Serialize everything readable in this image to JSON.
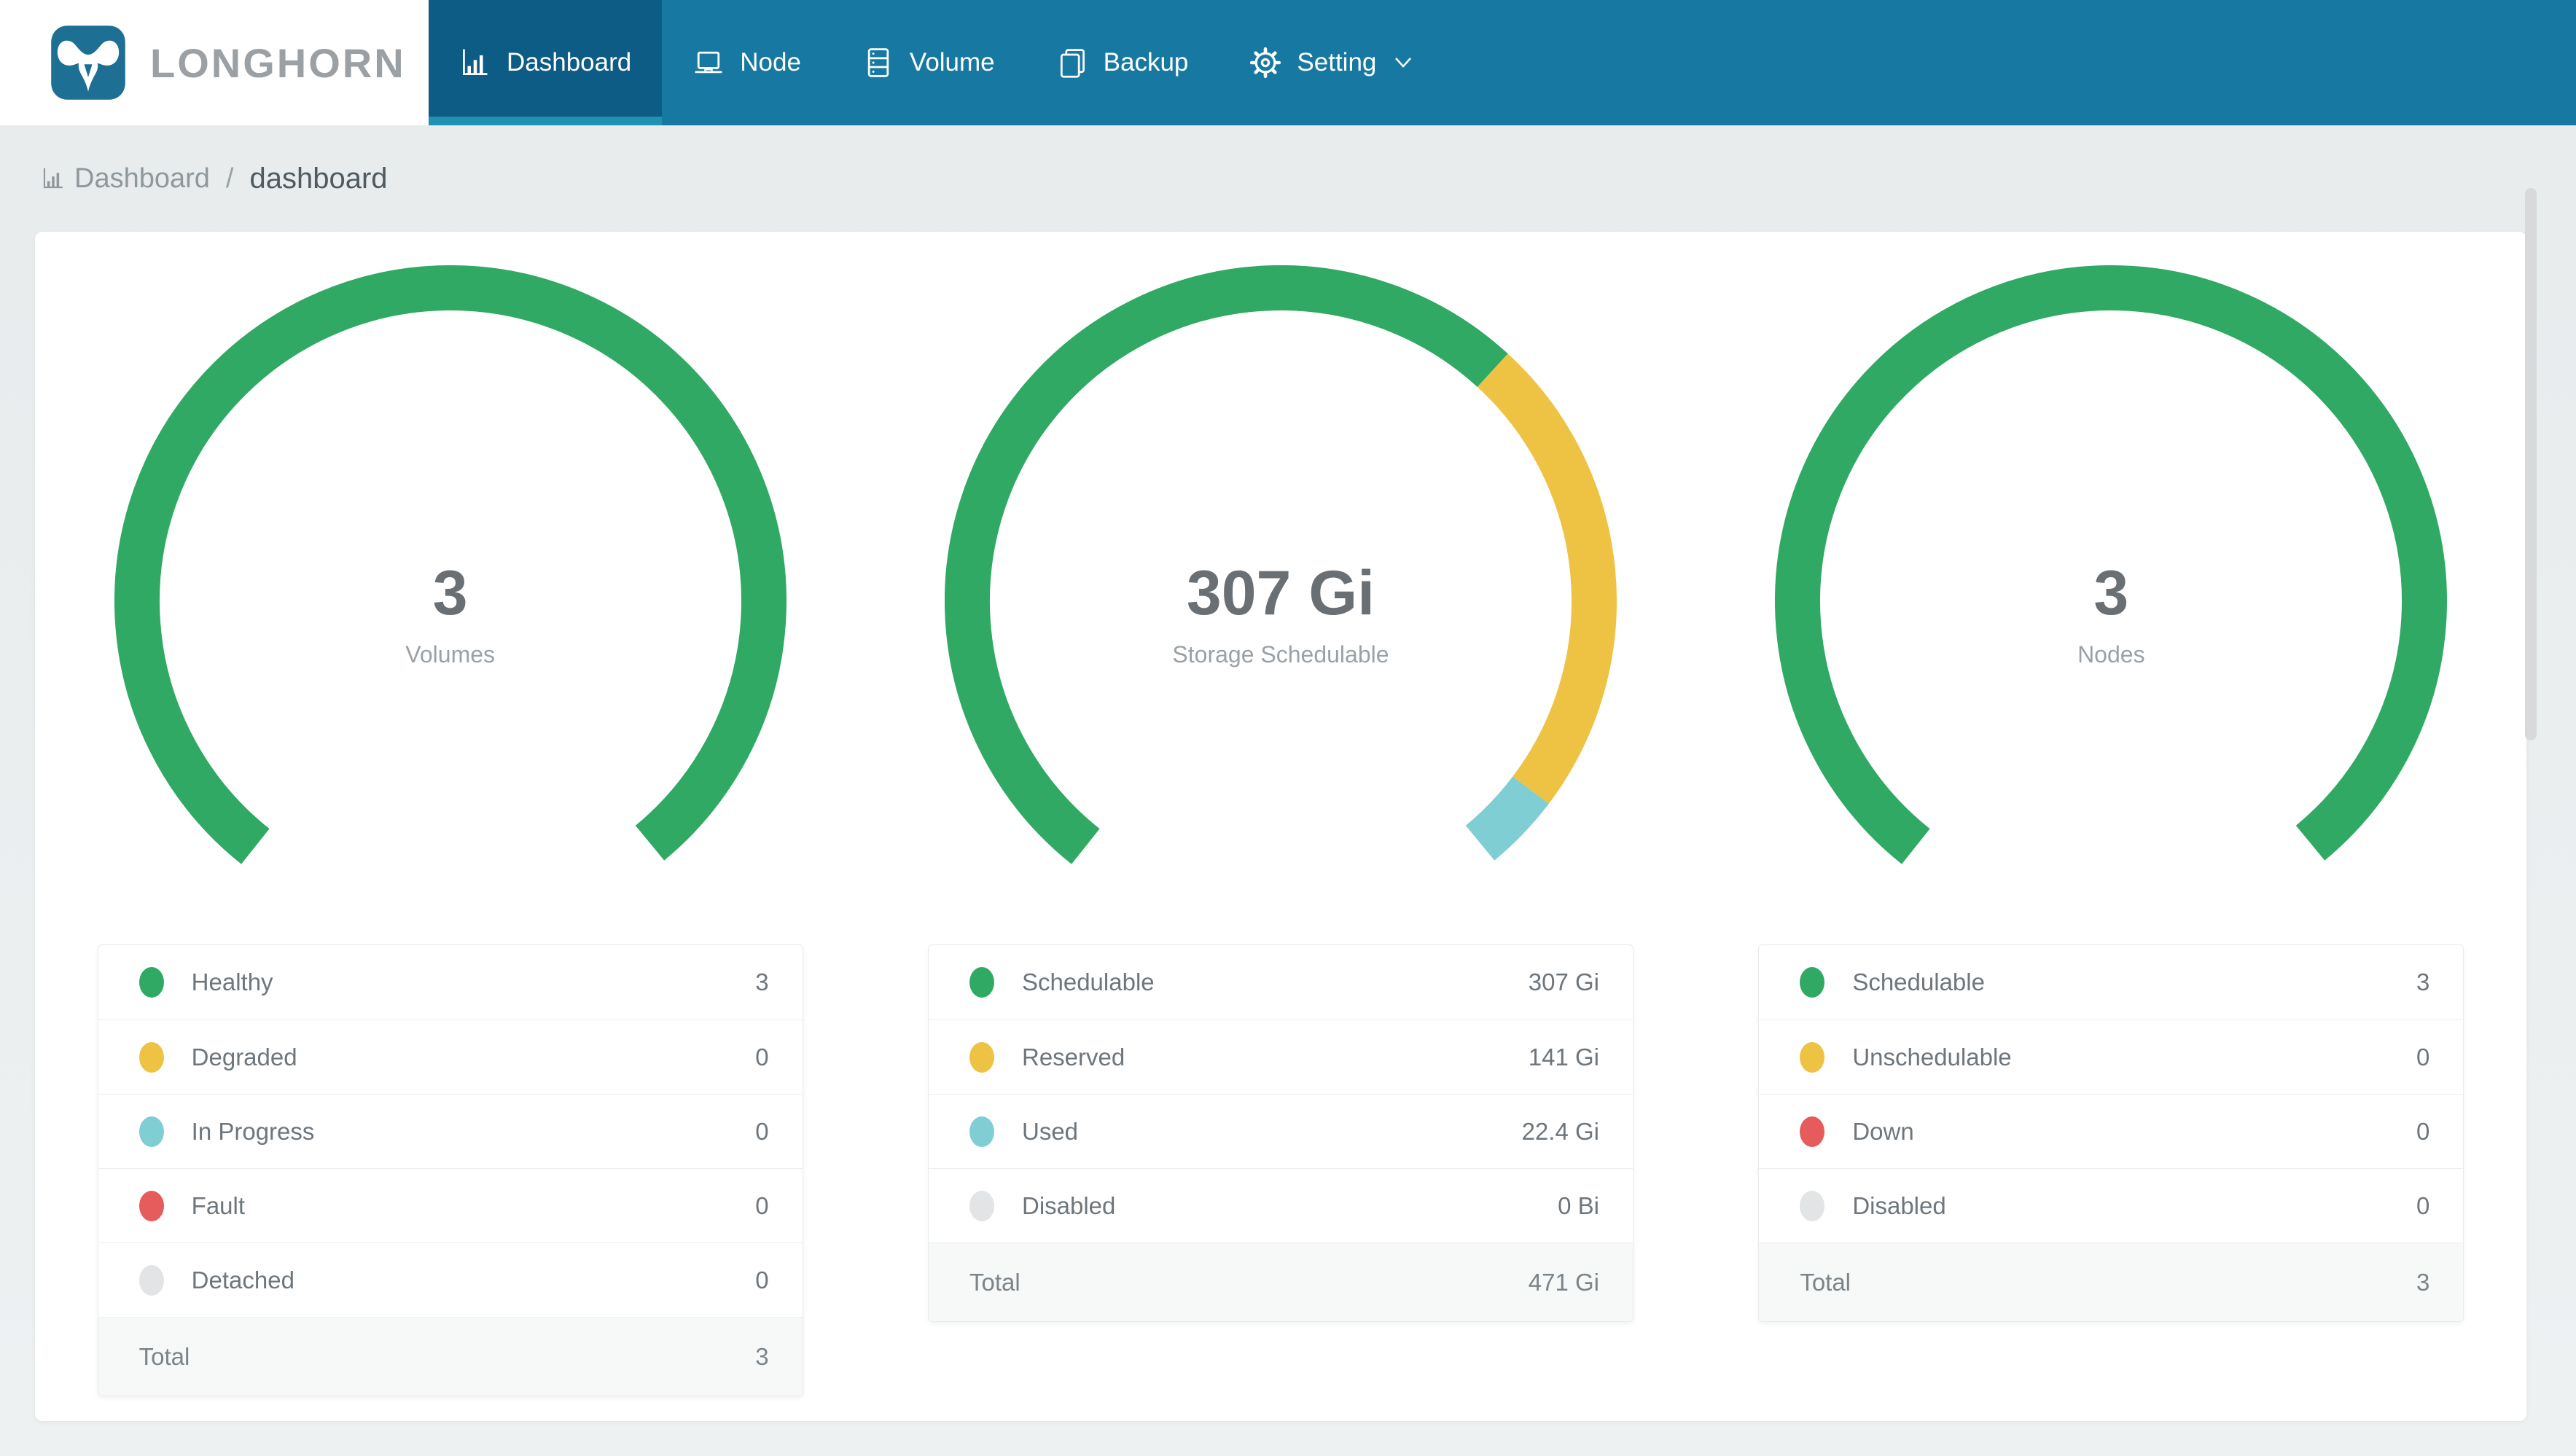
{
  "brand": {
    "name": "LONGHORN",
    "logo_icon": "longhorn-bull-icon"
  },
  "nav": {
    "items": [
      {
        "label": "Dashboard",
        "icon": "bar-chart-icon",
        "active": true
      },
      {
        "label": "Node",
        "icon": "laptop-icon",
        "active": false
      },
      {
        "label": "Volume",
        "icon": "database-icon",
        "active": false
      },
      {
        "label": "Backup",
        "icon": "copy-icon",
        "active": false
      },
      {
        "label": "Setting",
        "icon": "gear-icon",
        "active": false,
        "has_dropdown": true
      }
    ]
  },
  "breadcrumb": {
    "icon": "bar-chart-icon",
    "section": "Dashboard",
    "separator": "/",
    "page": "dashboard"
  },
  "colors": {
    "green": "#2fa963",
    "yellow": "#eec344",
    "teal": "#7fced3",
    "red": "#e65c5c",
    "gray": "#e2e4e5",
    "nav_blue": "#1779a1",
    "active_tab_blue": "#0d5c85",
    "active_underline_teal": "#2191b2",
    "logo_blue": "#1d6f94"
  },
  "chart_data": [
    {
      "type": "donut",
      "title": "Volumes",
      "center_value": "3",
      "center_label": "Volumes",
      "start_angle_deg": 128.5,
      "sweep_deg": 282,
      "stroke_width": 62,
      "segments": [
        {
          "label": "Healthy",
          "color": "green",
          "value": 3
        }
      ]
    },
    {
      "type": "donut",
      "title": "Storage Schedulable",
      "center_value": "307 Gi",
      "center_label": "Storage Schedulable",
      "start_angle_deg": 128.5,
      "sweep_deg": 282,
      "stroke_width": 62,
      "segments": [
        {
          "label": "Schedulable",
          "color": "green",
          "value": 307
        },
        {
          "label": "Reserved",
          "color": "yellow",
          "value": 141
        },
        {
          "label": "Used",
          "color": "teal",
          "value": 22.4
        }
      ]
    },
    {
      "type": "donut",
      "title": "Nodes",
      "center_value": "3",
      "center_label": "Nodes",
      "start_angle_deg": 128.5,
      "sweep_deg": 282,
      "stroke_width": 62,
      "segments": [
        {
          "label": "Schedulable",
          "color": "green",
          "value": 3
        }
      ]
    }
  ],
  "tables": [
    {
      "rows": [
        {
          "color": "green",
          "label": "Healthy",
          "value": "3"
        },
        {
          "color": "yellow",
          "label": "Degraded",
          "value": "0"
        },
        {
          "color": "teal",
          "label": "In Progress",
          "value": "0"
        },
        {
          "color": "red",
          "label": "Fault",
          "value": "0"
        },
        {
          "color": "gray",
          "label": "Detached",
          "value": "0"
        }
      ],
      "total": {
        "label": "Total",
        "value": "3"
      }
    },
    {
      "rows": [
        {
          "color": "green",
          "label": "Schedulable",
          "value": "307 Gi"
        },
        {
          "color": "yellow",
          "label": "Reserved",
          "value": "141 Gi"
        },
        {
          "color": "teal",
          "label": "Used",
          "value": "22.4 Gi"
        },
        {
          "color": "gray",
          "label": "Disabled",
          "value": "0 Bi"
        }
      ],
      "total": {
        "label": "Total",
        "value": "471 Gi"
      }
    },
    {
      "rows": [
        {
          "color": "green",
          "label": "Schedulable",
          "value": "3"
        },
        {
          "color": "yellow",
          "label": "Unschedulable",
          "value": "0"
        },
        {
          "color": "red",
          "label": "Down",
          "value": "0"
        },
        {
          "color": "gray",
          "label": "Disabled",
          "value": "0"
        }
      ],
      "total": {
        "label": "Total",
        "value": "3"
      }
    }
  ]
}
